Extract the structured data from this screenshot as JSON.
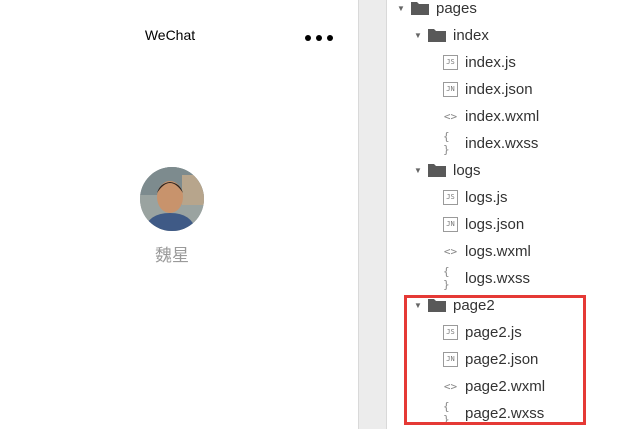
{
  "simulator": {
    "title": "WeChat",
    "menu_icon": "more-dots-icon",
    "nickname": "魏星"
  },
  "tree": {
    "pages": {
      "label": "pages"
    },
    "folders": [
      {
        "label": "index",
        "files": [
          "index.js",
          "index.json",
          "index.wxml",
          "index.wxss"
        ]
      },
      {
        "label": "logs",
        "files": [
          "logs.js",
          "logs.json",
          "logs.wxml",
          "logs.wxss"
        ]
      },
      {
        "label": "page2",
        "files": [
          "page2.js",
          "page2.json",
          "page2.wxml",
          "page2.wxss"
        ]
      }
    ],
    "file_icons": {
      "js": "JS",
      "json": "JN",
      "wxml": "<>",
      "wxss": "{ }"
    }
  },
  "colors": {
    "highlight": "#e53935"
  }
}
